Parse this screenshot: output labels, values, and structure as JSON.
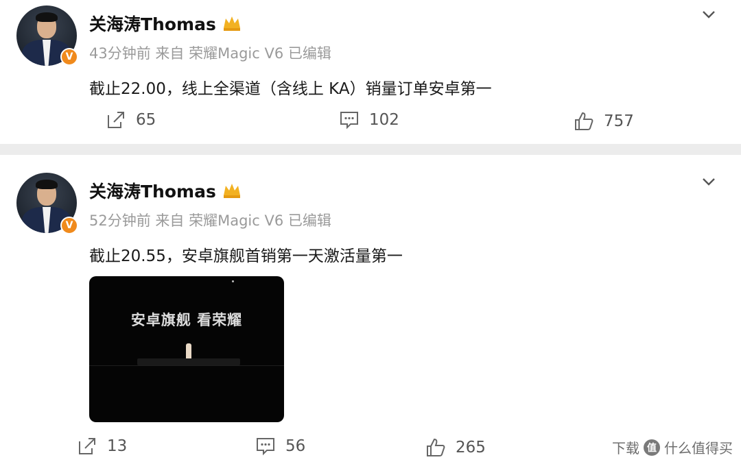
{
  "posts": [
    {
      "author": "关海涛Thomas",
      "time": "43分钟前",
      "source": "来自 荣耀Magic V6",
      "edited": "已编辑",
      "verified_badge": "V",
      "text": "截止22.00，线上全渠道（含线上 KA）销量订单安卓第一",
      "reposts": "65",
      "comments": "102",
      "likes": "757"
    },
    {
      "author": "关海涛Thomas",
      "time": "52分钟前",
      "source": "来自 荣耀Magic V6",
      "edited": "已编辑",
      "verified_badge": "V",
      "text": "截止20.55，安卓旗舰首销第一天激活量第一",
      "video_caption": "安卓旗舰 看荣耀",
      "reposts": "13",
      "comments": "56",
      "likes": "265"
    }
  ],
  "watermark": {
    "prefix": "下载",
    "badge": "值",
    "brand": "什么值得买"
  },
  "colors": {
    "verified_badge": "#f08a1c",
    "crown": "#f2b122",
    "separator": "#ececec",
    "meta_text": "#9a9a9a"
  }
}
